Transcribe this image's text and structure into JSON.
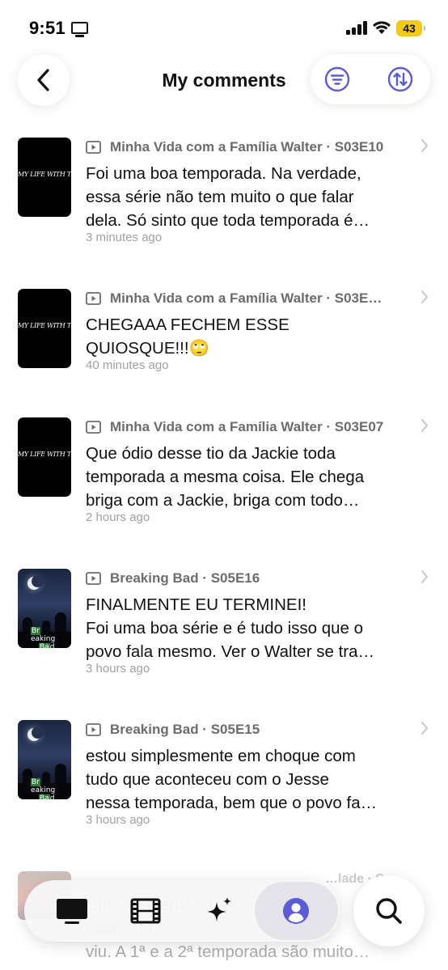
{
  "status_bar": {
    "time": "9:51",
    "battery": "43"
  },
  "header": {
    "title": "My comments"
  },
  "comments": [
    {
      "meta": "Minha Vida com a Família Walter · S03E10",
      "lines": [
        "Foi uma boa temporada. Na verdade,",
        "essa série não tem muito o que falar",
        "dela. Só sinto que toda temporada é…"
      ],
      "time": "3 minutes ago",
      "poster_text": "MY LIFE WITH THE WALTER BOYS"
    },
    {
      "meta": "Minha Vida com a Família Walter · S03E…",
      "lines": [
        "CHEGAAA FECHEM ESSE",
        "QUIOSQUE!!!🙄"
      ],
      "time": "40 minutes ago",
      "poster_text": "MY LIFE WITH THE WALTER BOYS"
    },
    {
      "meta": "Minha Vida com a Família Walter · S03E07",
      "lines": [
        "Que ódio desse tio da Jackie toda",
        "temporada a mesma coisa. Ele chega",
        "briga com a Jackie, briga com todo…"
      ],
      "time": "2 hours ago",
      "poster_text": "MY LIFE WITH THE WALTER BOYS"
    },
    {
      "meta": "Breaking Bad · S05E16",
      "lines": [
        "FINALMENTE EU TERMINEI!",
        "Foi uma boa série e é tudo isso que o",
        "povo fala mesmo. Ver o Walter se tra…"
      ],
      "time": "3 hours ago",
      "poster_text": [
        "Br",
        "eaking",
        "Ba",
        "d"
      ]
    },
    {
      "meta": "Breaking Bad · S05E15",
      "lines": [
        "estou simplesmente em choque com",
        "tudo que aconteceu com o Jesse",
        "nessa temporada, bem que o povo fa…"
      ],
      "time": "3 hours ago",
      "poster_text": [
        "Br",
        "eaking",
        "Ba",
        "d"
      ]
    }
  ],
  "partial_comment": {
    "meta": "…lade · S",
    "lines": [
      "Olha, …mente…u te… …u",
      "falar… fa",
      "viu. A 1ª e a 2ª temporada são muito…"
    ]
  },
  "tab_bar": {
    "tabs": [
      "tv-icon",
      "film-icon",
      "sparkles-icon",
      "profile-icon"
    ],
    "active_tab": "profile-icon",
    "accent_color": "#5b5bd6"
  },
  "icons": {
    "back": "chevron-left-icon",
    "filter": "filter-icon",
    "sort": "sort-icon",
    "search": "search-icon"
  }
}
